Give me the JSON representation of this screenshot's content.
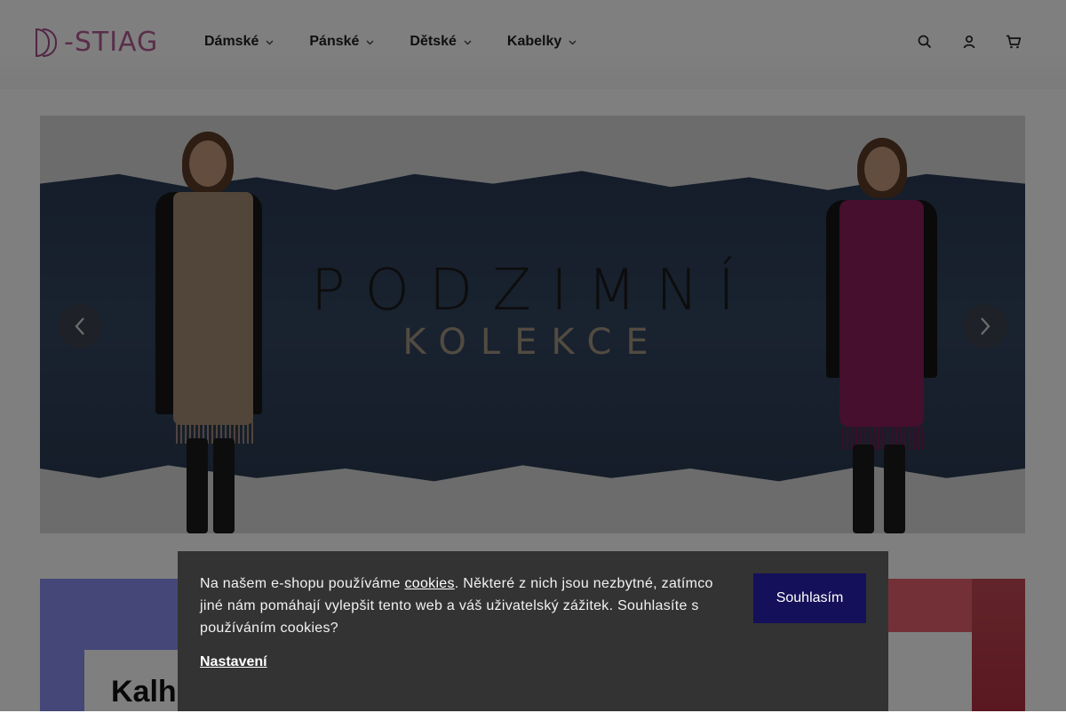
{
  "logo": {
    "text": "-STIAG",
    "mark": "D"
  },
  "nav": {
    "items": [
      {
        "label": "Dámské"
      },
      {
        "label": "Pánské"
      },
      {
        "label": "Dětské"
      },
      {
        "label": "Kabelky"
      }
    ],
    "chevron": "chevron-down-icon"
  },
  "header_icons": [
    "search-icon",
    "user-icon",
    "cart-icon"
  ],
  "hero": {
    "title": "PODZIMNÍ",
    "subtitle": "KOLEKCE",
    "prev_icon": "chevron-left-icon",
    "next_icon": "chevron-right-icon"
  },
  "tiles": {
    "left_title": "Kalho"
  },
  "cookie": {
    "text_before": "Na našem e-shopu používáme ",
    "link": "cookies",
    "text_after": ". Některé z nich jsou nezbytné, zatímco jiné nám pomáhají vylepšit tento web a váš uživatelský zážitek. Souhlasíte s  používáním cookies?",
    "settings": "Nastavení",
    "accept": "Souhlasím"
  },
  "colors": {
    "logo": "#b45d95",
    "accept_button": "#15105a",
    "cookie_bg": "#333333",
    "tile_left": "#8b8ff0",
    "tile_right": "#e9606e"
  }
}
